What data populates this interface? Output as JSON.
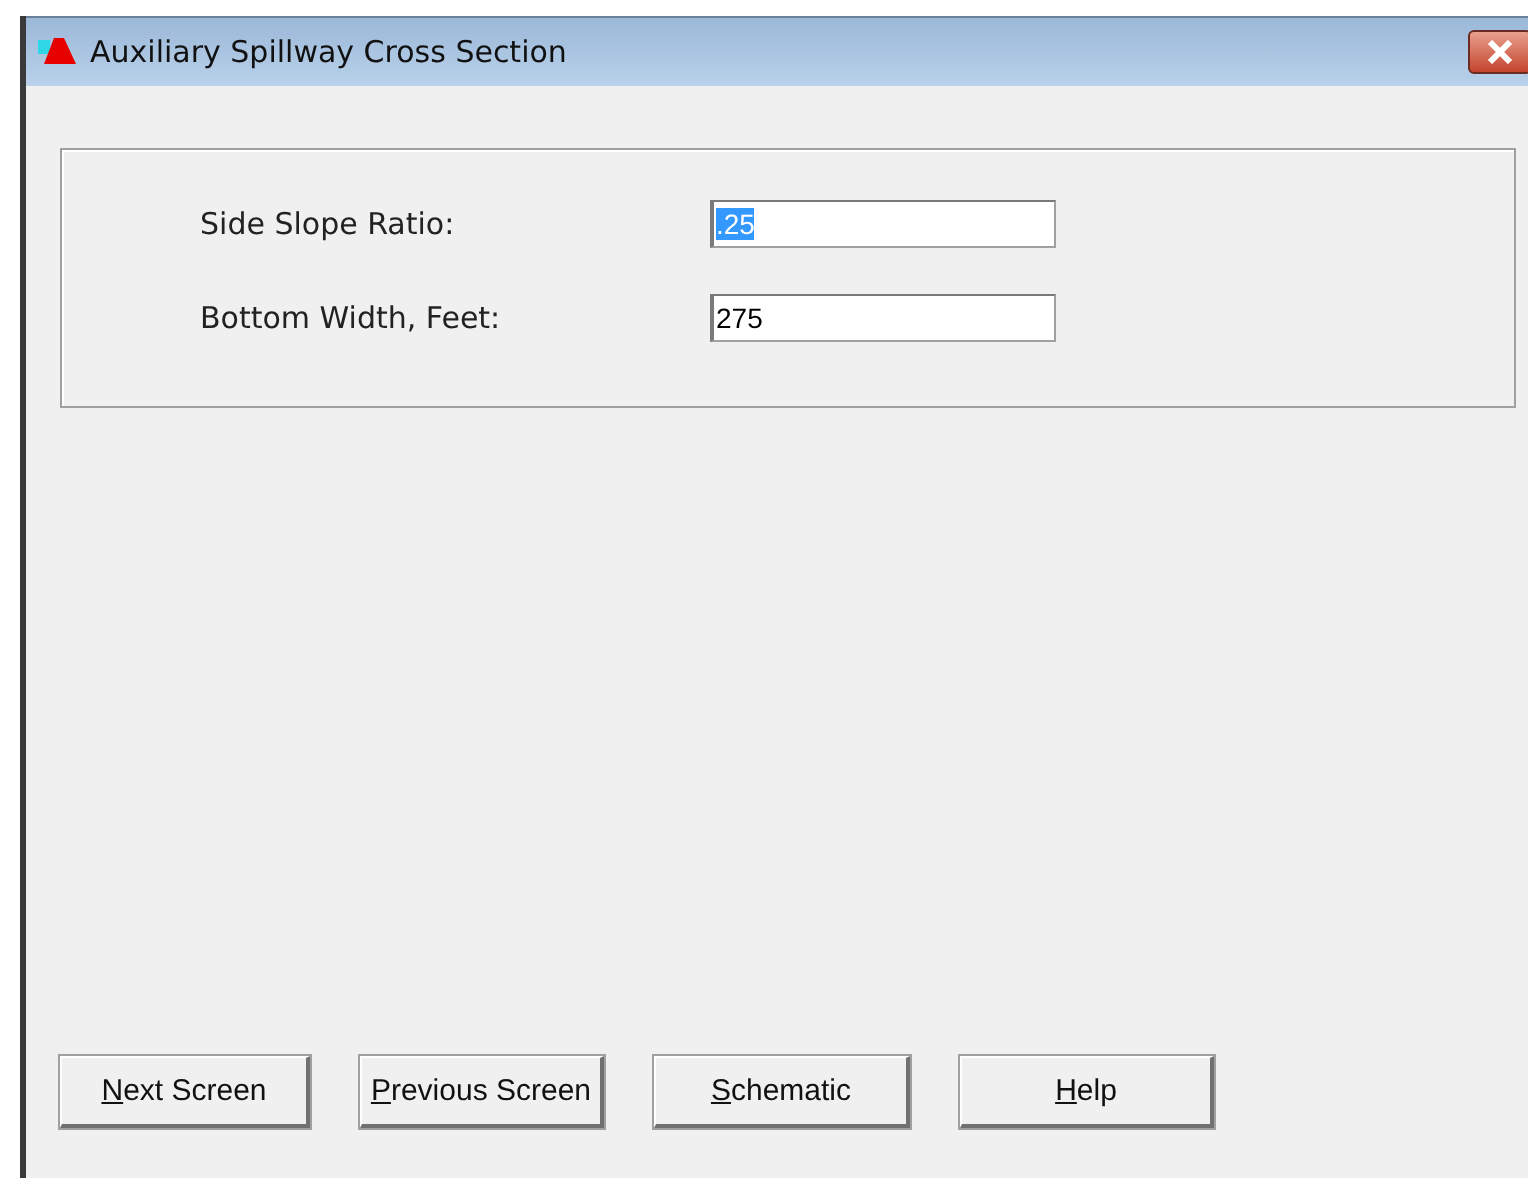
{
  "window": {
    "title": "Auxiliary Spillway Cross Section"
  },
  "fields": [
    {
      "label": "Side Slope Ratio:",
      "value": ".25",
      "selected": true
    },
    {
      "label": "Bottom Width, Feet:",
      "value": "275",
      "selected": false
    }
  ],
  "buttons": [
    {
      "label": "Next Screen",
      "mnemonic": true
    },
    {
      "label": "Previous Screen",
      "mnemonic": true
    },
    {
      "label": "Schematic",
      "mnemonic": true
    },
    {
      "label": "Help",
      "mnemonic": true
    }
  ]
}
